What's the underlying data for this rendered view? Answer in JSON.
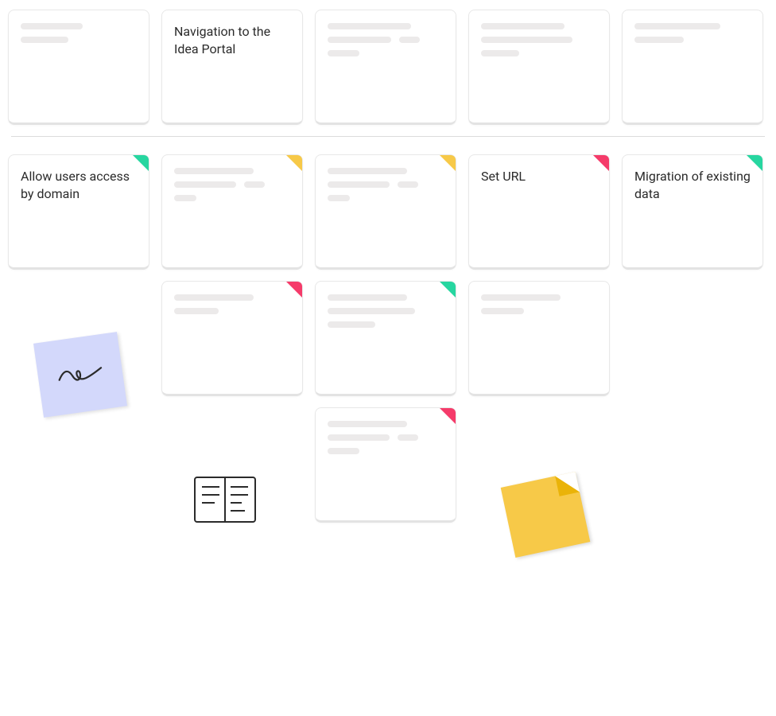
{
  "colors": {
    "green": "#27d6a0",
    "yellow": "#f7c948",
    "pink": "#f53b6a",
    "sticky_blue": "#d3d8fb",
    "sticky_yellow": "#f7c948"
  },
  "rows": {
    "top": [
      {
        "text": null,
        "tag": null,
        "lines": [
          [
            78
          ],
          [
            60
          ]
        ]
      },
      {
        "text": "Navigation to the Idea Portal",
        "tag": null,
        "lines": null
      },
      {
        "text": null,
        "tag": null,
        "lines": [
          [
            105
          ],
          [
            80,
            26
          ],
          [
            40
          ]
        ]
      },
      {
        "text": null,
        "tag": null,
        "lines": [
          [
            105
          ],
          [
            115
          ],
          [
            48
          ]
        ]
      },
      {
        "text": null,
        "tag": null,
        "lines": [
          [
            108
          ],
          [
            62
          ]
        ]
      }
    ],
    "second": [
      {
        "text": "Allow users access by domain",
        "tag": "green",
        "lines": null
      },
      {
        "text": null,
        "tag": "yellow",
        "lines": [
          [
            100
          ],
          [
            78,
            26
          ],
          [
            28
          ]
        ]
      },
      {
        "text": null,
        "tag": "yellow",
        "lines": [
          [
            100
          ],
          [
            78,
            26
          ],
          [
            28
          ]
        ]
      },
      {
        "text": "Set URL",
        "tag": "pink",
        "lines": null
      },
      {
        "text": "Migration of existing data",
        "tag": "green",
        "lines": null
      }
    ],
    "third": [
      {
        "text": null,
        "tag": "pink",
        "lines": [
          [
            100
          ],
          [
            56
          ]
        ]
      },
      {
        "text": null,
        "tag": "green",
        "lines": [
          [
            100
          ],
          [
            110
          ],
          [
            60
          ]
        ]
      },
      {
        "text": null,
        "tag": null,
        "lines": [
          [
            100
          ],
          [
            54
          ]
        ]
      }
    ],
    "fourth": [
      {
        "text": null,
        "tag": "pink",
        "lines": [
          [
            100
          ],
          [
            78,
            26
          ],
          [
            40
          ]
        ]
      }
    ]
  },
  "decorations": {
    "sticky_blue": "squiggle-note",
    "open_book": "open-book-icon",
    "sticky_yellow": "yellow-note"
  }
}
